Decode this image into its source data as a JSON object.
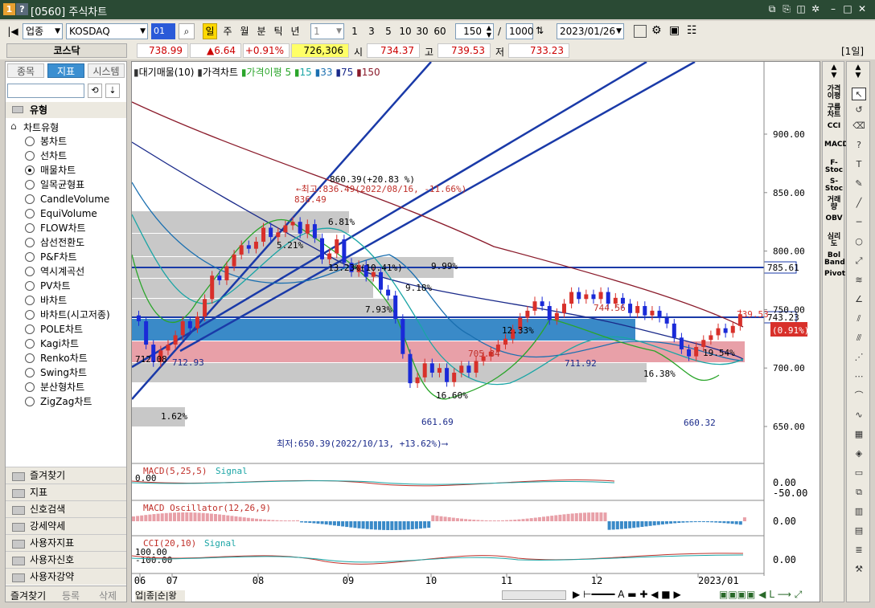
{
  "window": {
    "title_number": "1",
    "title_help": "?",
    "title": "[0560] 주식차트"
  },
  "toolbar": {
    "market": "업종",
    "symbol": "KOSDAQ",
    "code_badge": "01",
    "periods": [
      "일",
      "주",
      "월",
      "분",
      "틱",
      "년"
    ],
    "selected_period": "일",
    "unit_value": "1",
    "multipliers": [
      "1",
      "3",
      "5",
      "10",
      "30",
      "60"
    ],
    "count": "150",
    "slash": "/",
    "max_count": "1000",
    "date": "2023/01/26"
  },
  "quote": {
    "name": "코스닥",
    "price": "738.99",
    "change": "▲6.64",
    "change_pct": "+0.91%",
    "volume": "726,306",
    "open_label": "시",
    "open": "734.37",
    "high_label": "고",
    "high": "739.53",
    "low_label": "저",
    "low": "733.23",
    "period_badge": "[1일]"
  },
  "left_panel": {
    "tabs": [
      "종목",
      "지표",
      "시스템"
    ],
    "active_tab": "지표",
    "section_title": "유형",
    "tree_root": "차트유형",
    "chart_types": [
      "봉차트",
      "선차트",
      "매물차트",
      "일목균형표",
      "CandleVolume",
      "EquiVolume",
      "FLOW차트",
      "삼선전환도",
      "P&F차트",
      "역시계곡선",
      "PV차트",
      "바차트",
      "바차트(시고저종)",
      "POLE차트",
      "Kagi차트",
      "Renko차트",
      "Swing차트",
      "분산형차트",
      "ZigZag차트"
    ],
    "selected_type": "매물차트",
    "folders": [
      "즐겨찾기",
      "지표",
      "신호검색",
      "강세약세",
      "사용자지표",
      "사용자신호",
      "사용자강약"
    ],
    "bottom_tabs": [
      "즐겨찾기",
      "등록",
      "삭제"
    ]
  },
  "chart": {
    "legend": {
      "volume_profile": "대기매물(10)",
      "price_chart": "가격차트",
      "ma_title": "가격이평",
      "ma_periods": [
        "5",
        "15",
        "33",
        "75",
        "150"
      ],
      "ma_colors": [
        "#2aa52a",
        "#1aa5a5",
        "#1a6fb0",
        "#1a2a8a",
        "#8a1a2a"
      ]
    },
    "y_axis_labels": [
      "900.00",
      "850.00",
      "800.00",
      "750.00",
      "700.00",
      "650.00"
    ],
    "x_axis_labels": [
      "06",
      "07",
      "08",
      "09",
      "10",
      "11",
      "12",
      "2023/01"
    ],
    "price_tags": {
      "level_1": "785.61",
      "current": "743.23",
      "current_tag": "739.53",
      "change_tag": "(0.91%)"
    },
    "annotations": {
      "high_label": "860.39(+20.83 %)",
      "high_note": "←최고:836.49(2022/08/16, -11.66%)",
      "peak": "836.49",
      "low_note": "최저:650.39(2022/10/13, +13.62%)⟶",
      "low_1": "661.69",
      "low_2": "660.32",
      "peak_2": "744.56",
      "peak_3": "705.84",
      "peak_4": "711.92",
      "last_tag": "739.53",
      "left_val": "712.08",
      "left_val2": "712.93",
      "pct_labels": [
        "6.81%",
        "5.21%",
        "9.99%",
        "9.18%",
        "7.93%",
        "12.33%",
        "16.60%",
        "1.62%",
        "16.38%",
        "19.54%",
        "13.23%(10.41%)"
      ]
    },
    "macd": {
      "title": "MACD(5,25,5)",
      "signal": "Signal",
      "left_value": "0.00",
      "axis": [
        "0.00",
        "-50.00"
      ]
    },
    "macd_osc": {
      "title": "MACD Oscillator(12,26,9)",
      "axis": [
        "0.00"
      ]
    },
    "cci": {
      "title": "CCI(20,10)",
      "signal": "Signal",
      "levels": [
        "100.00",
        "-100.00"
      ],
      "axis": [
        "0.00"
      ]
    },
    "bottom_tabs": [
      "업",
      "종",
      "순",
      "왕"
    ]
  },
  "right_bar_1": [
    "가격이평",
    "구름차트",
    "CCI",
    "MACD",
    "F-Stoc",
    "S-Stoc",
    "거래량",
    "OBV",
    "심리도",
    "Bol Band",
    "Pivot"
  ],
  "colors": {
    "titlebar": "#2a4a34",
    "up": "#d8302a",
    "down": "#1a2ad8",
    "vp_gray": "#c8c8c8",
    "vp_blue": "#3a8ac8",
    "vp_pink": "#e8a0a8"
  }
}
